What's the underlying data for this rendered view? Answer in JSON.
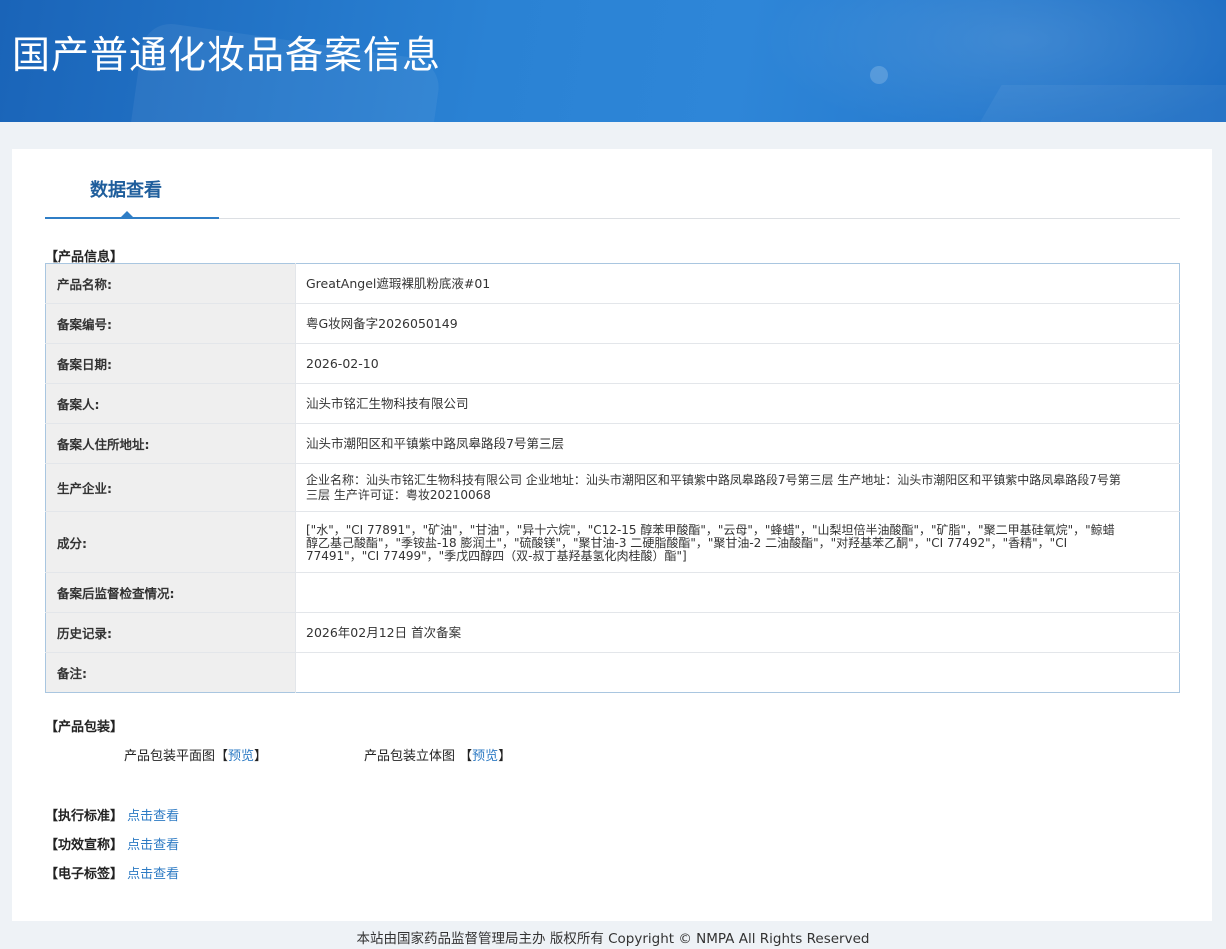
{
  "header": {
    "title": "国产普通化妆品备案信息"
  },
  "tabs": [
    {
      "label": "数据查看",
      "active": true
    }
  ],
  "product_info": {
    "section_label": "【产品信息】",
    "rows": [
      {
        "label": "产品名称:",
        "value": "GreatAngel遮瑕裸肌粉底液#01"
      },
      {
        "label": "备案编号:",
        "value": "粤G妆网备字2026050149"
      },
      {
        "label": "备案日期:",
        "value": "2026-02-10"
      },
      {
        "label": "备案人:",
        "value": "汕头市铭汇生物科技有限公司"
      },
      {
        "label": "备案人住所地址:",
        "value": "汕头市潮阳区和平镇紫中路凤皋路段7号第三层"
      },
      {
        "label": "生产企业:",
        "value": "企业名称：汕头市铭汇生物科技有限公司 企业地址：汕头市潮阳区和平镇紫中路凤皋路段7号第三层 生产地址：汕头市潮阳区和平镇紫中路凤皋路段7号第三层 生产许可证：粤妆20210068"
      },
      {
        "label": "成分:",
        "value": "[\"水\"，\"CI 77891\"，\"矿油\"，\"甘油\"，\"异十六烷\"，\"C12-15 醇苯甲酸酯\"，\"云母\"，\"蜂蜡\"，\"山梨坦倍半油酸酯\"，\"矿脂\"，\"聚二甲基硅氧烷\"，\"鲸蜡醇乙基己酸酯\"，\"季铵盐-18 膨润土\"，\"硫酸镁\"，\"聚甘油-3 二硬脂酸酯\"，\"聚甘油-2 二油酸酯\"，\"对羟基苯乙酮\"，\"CI 77492\"，\"香精\"，\"CI 77491\"，\"CI 77499\"，\"季戊四醇四（双-叔丁基羟基氢化肉桂酸）酯\"]"
      },
      {
        "label": "备案后监督检查情况:",
        "value": ""
      },
      {
        "label": "历史记录:",
        "value": "2026年02月12日 首次备案"
      },
      {
        "label": "备注:",
        "value": ""
      }
    ]
  },
  "packaging": {
    "section_label": "【产品包装】",
    "flat_label": "产品包装平面图",
    "three_d_label": "产品包装立体图",
    "bracket_open": "【",
    "bracket_close": "】",
    "preview_label": "预览"
  },
  "links": [
    {
      "label": "【执行标准】",
      "action": "点击查看"
    },
    {
      "label": "【功效宣称】",
      "action": "点击查看"
    },
    {
      "label": "【电子标签】",
      "action": "点击查看"
    }
  ],
  "footer": {
    "text": "本站由国家药品监督管理局主办 版权所有 Copyright © NMPA All Rights Reserved"
  },
  "colors": {
    "banner": "#2a82d4",
    "accent": "#2f7ec6",
    "link": "#2e7bc4",
    "label_bg": "#efefef"
  }
}
